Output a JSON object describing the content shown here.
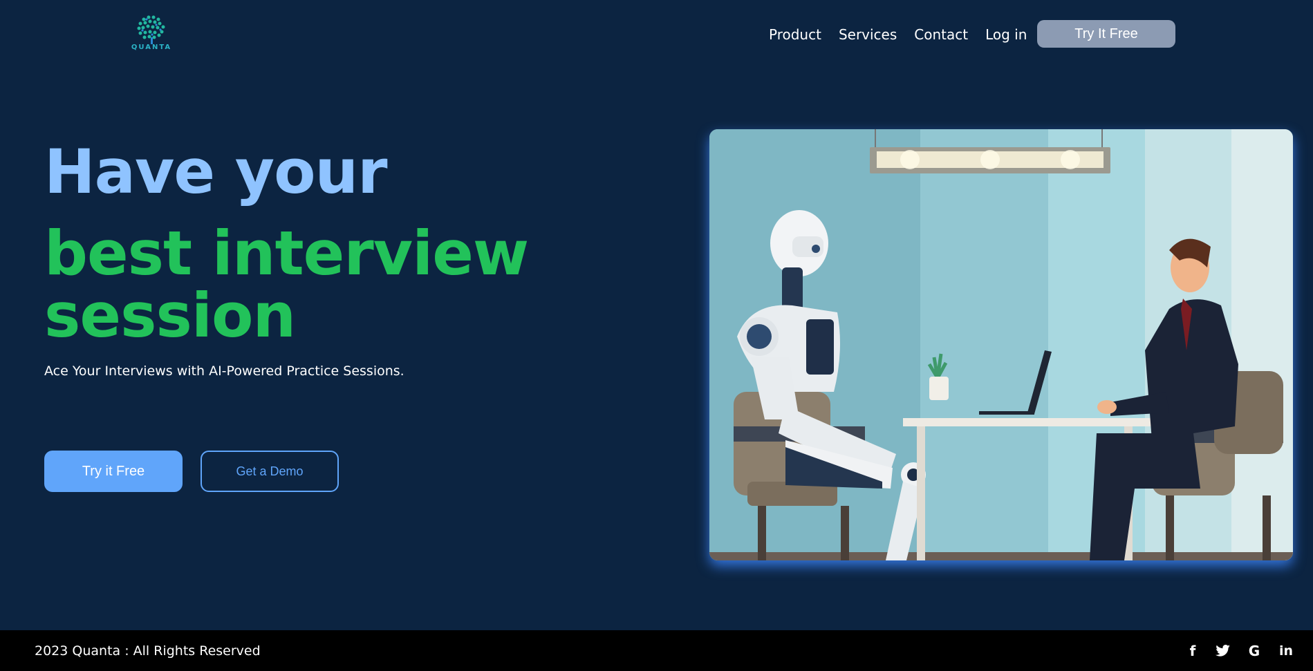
{
  "nav": {
    "logo_text": "QUANTA",
    "links": [
      "Product",
      "Services",
      "Contact",
      "Log in"
    ],
    "cta_label": "Try It Free"
  },
  "hero": {
    "title_line1": "Have your",
    "title_line2": "best interview session",
    "subtitle": "Ace Your Interviews with AI-Powered Practice Sessions.",
    "primary_button": "Try it Free",
    "secondary_button": "Get a Demo"
  },
  "footer": {
    "copyright": "2023 Quanta : All Rights Reserved",
    "social_icons": [
      "facebook-icon",
      "twitter-icon",
      "google-icon",
      "linkedin-icon"
    ]
  },
  "colors": {
    "background": "#0c2441",
    "title_blue": "#8fc3ff",
    "title_green": "#22c25a",
    "primary": "#60a5fa",
    "nav_cta": "#8c9bb3",
    "footer": "#000000"
  }
}
